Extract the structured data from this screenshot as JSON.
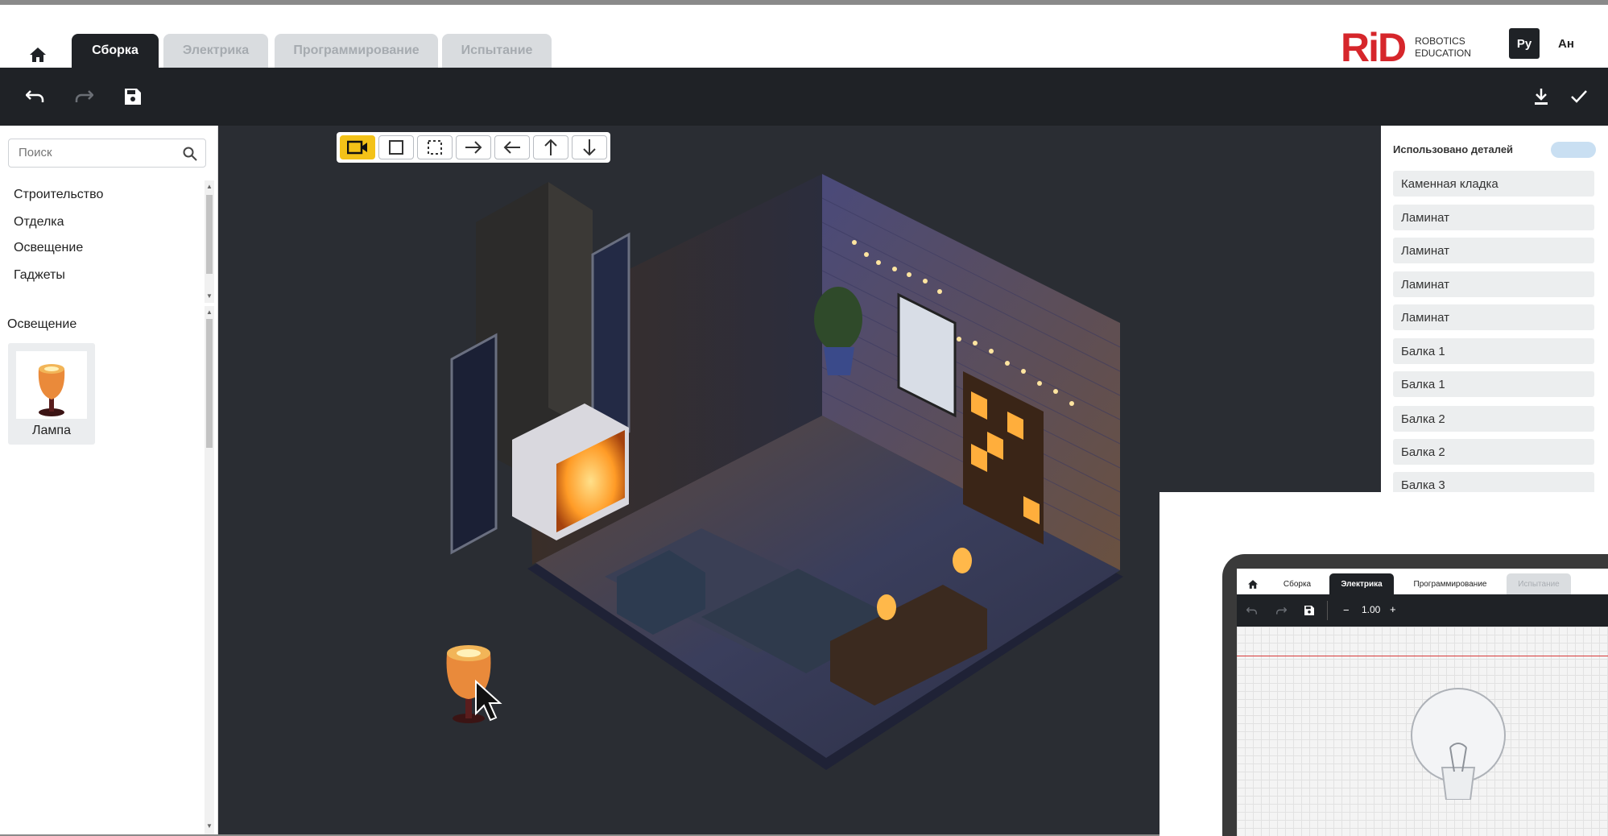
{
  "tabs": [
    {
      "label": "Сборка",
      "state": "active"
    },
    {
      "label": "Электрика",
      "state": "inactive"
    },
    {
      "label": "Программирование",
      "state": "inactive"
    },
    {
      "label": "Испытание",
      "state": "inactive"
    }
  ],
  "brand": {
    "mark": "RiD",
    "line1": "ROBOTICS",
    "line2": "EDUCATION",
    "color": "#d6262b"
  },
  "languages": {
    "ru": "Ру",
    "en": "Ан"
  },
  "toolbar": {
    "icons": [
      "undo-icon",
      "redo-icon",
      "save-icon",
      "download-icon",
      "check-icon"
    ]
  },
  "sidebar": {
    "search_placeholder": "Поиск",
    "categories": [
      "Строительство",
      "Отделка",
      "Освещение",
      "Гаджеты"
    ],
    "section_title": "Освещение",
    "parts": [
      {
        "label": "Лампа"
      }
    ]
  },
  "view_tools": [
    "camera-icon",
    "square-icon",
    "dashed-square-icon",
    "arrow-right-icon",
    "arrow-left-icon",
    "arrow-up-icon",
    "arrow-down-icon"
  ],
  "right_panel": {
    "title": "Использовано деталей",
    "items": [
      "Каменная кладка",
      "Ламинат",
      "Ламинат",
      "Ламинат",
      "Ламинат",
      "Балка 1",
      "Балка 1",
      "Балка 2",
      "Балка 2",
      "Балка 3"
    ]
  },
  "inset": {
    "tabs": [
      "Сборка",
      "Электрика",
      "Программирование",
      "Испытание"
    ],
    "active_tab": "Электрика",
    "zoom_minus": "−",
    "zoom_value": "1.00",
    "zoom_plus": "+"
  },
  "colors": {
    "accent": "#f3c218",
    "dark": "#1f2226",
    "viewport": "#2a2d33"
  }
}
